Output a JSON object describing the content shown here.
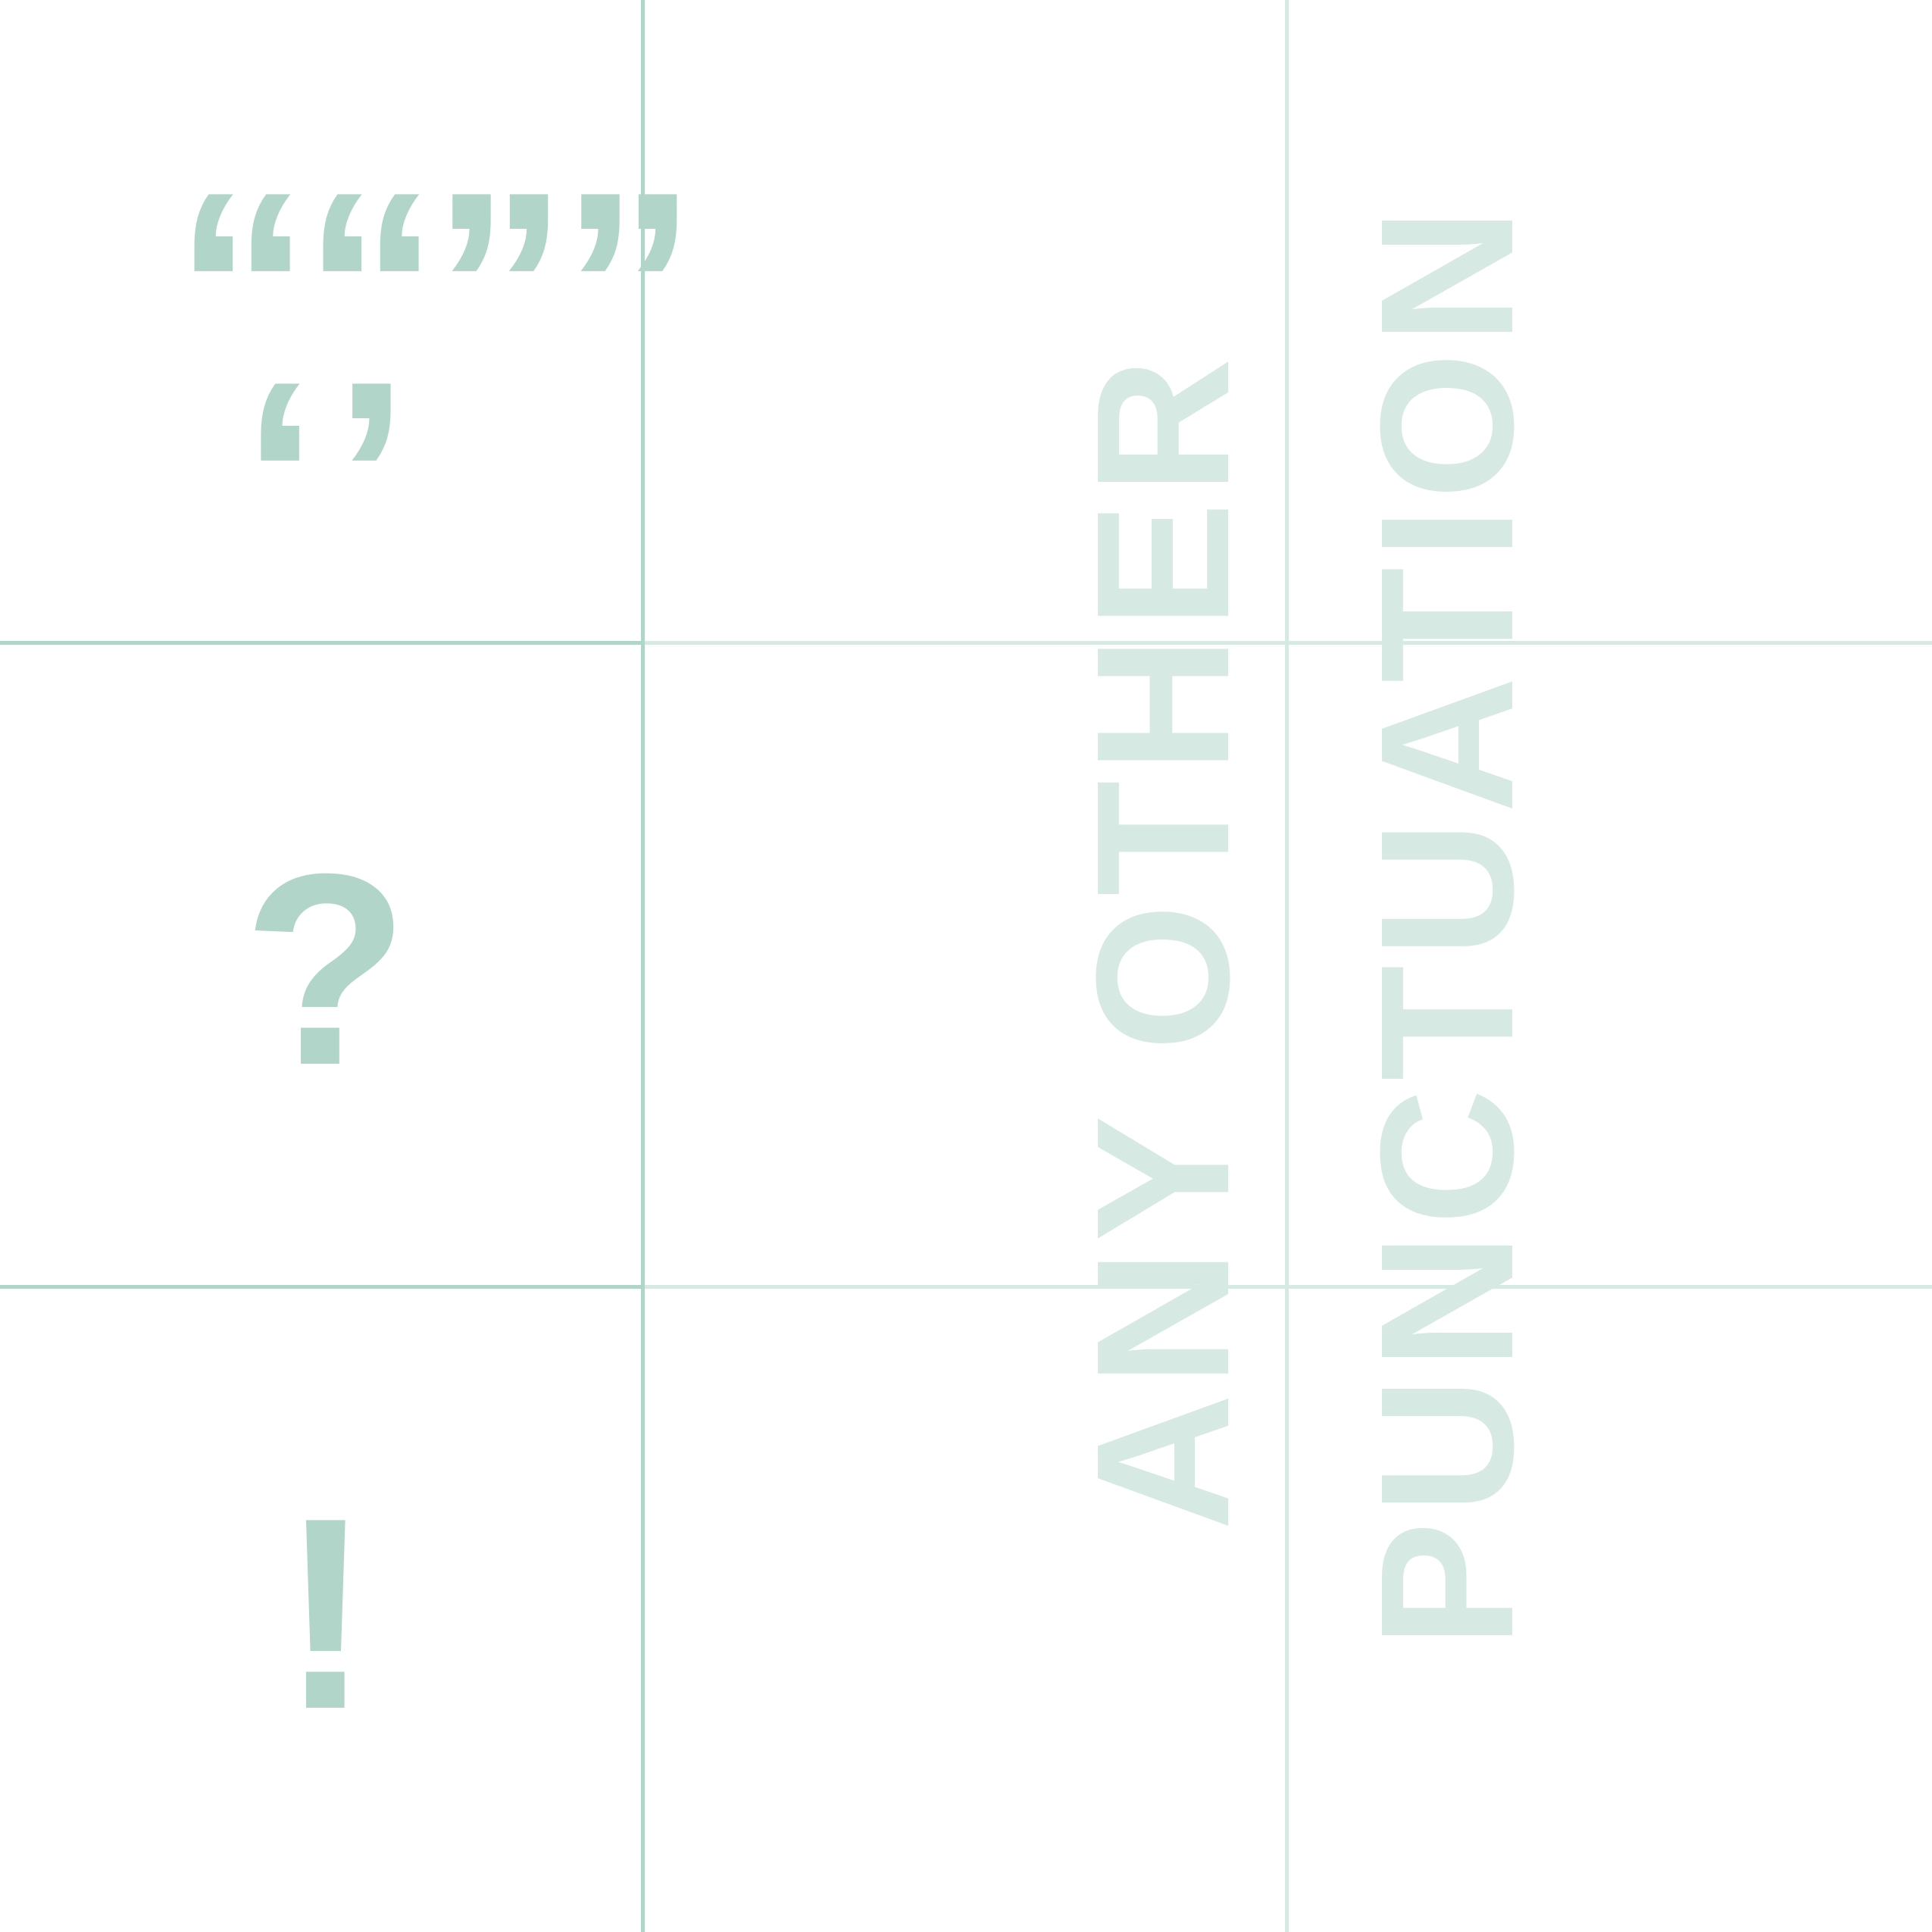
{
  "colors": {
    "background": "#ffffff",
    "glyph": "#b2d5ca",
    "text_light": "#d6e9e3",
    "grid_strong": "#b2d5ca",
    "grid_light": "#d6e9e3"
  },
  "glyphs": {
    "double_quotes": "““””",
    "single_quotes": "‘’",
    "question_mark": "?",
    "exclamation_mark": "!"
  },
  "text": {
    "line1": "ANY OTHER",
    "line2": "PUNCTUATION"
  }
}
